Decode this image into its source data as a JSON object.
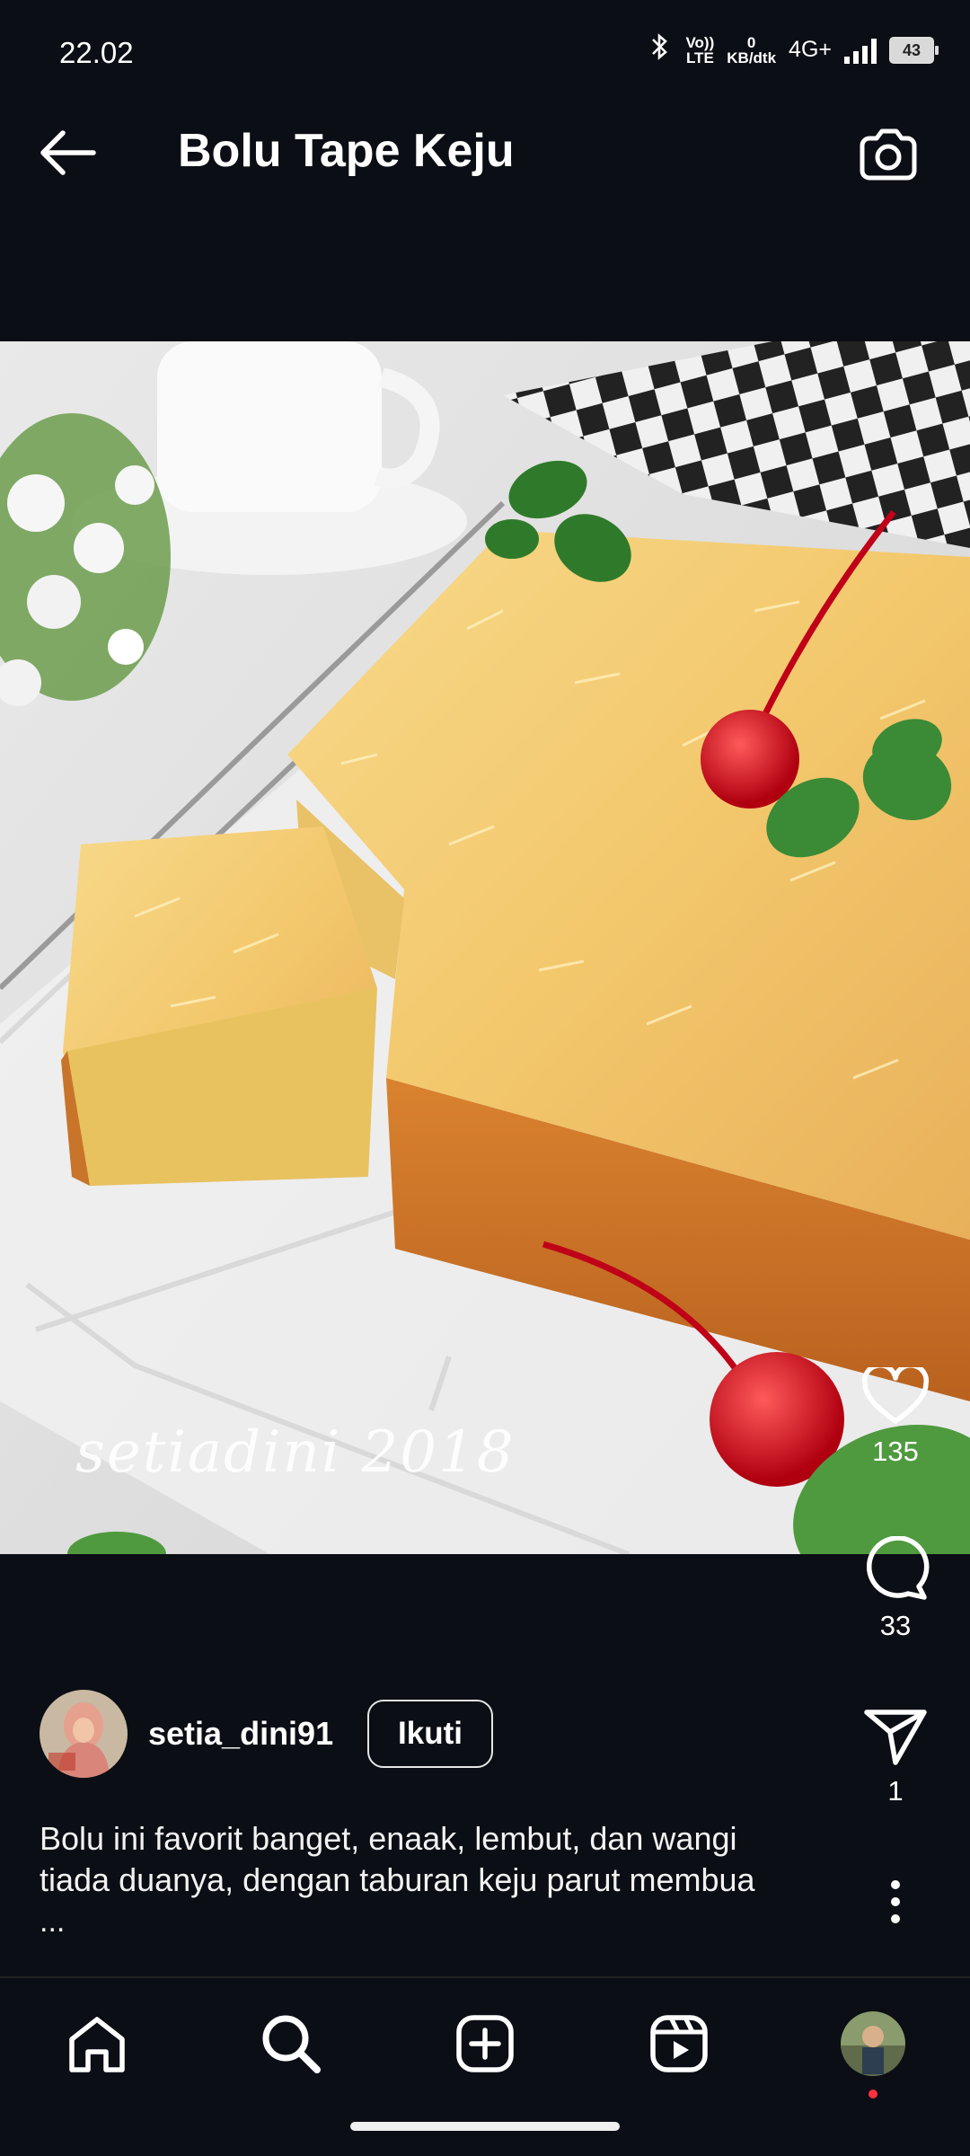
{
  "status_bar": {
    "time": "22.02",
    "network_top": "Vo))",
    "network_bottom": "LTE",
    "speed_top": "0",
    "speed_bottom": "KB/dtk",
    "network_type": "4G+",
    "battery": "43"
  },
  "header": {
    "title": "Bolu Tape Keju"
  },
  "photo": {
    "watermark": "setiadini  2018"
  },
  "actions": {
    "likes": "135",
    "comments": "33",
    "shares": "1"
  },
  "author": {
    "username": "setia_dini91",
    "follow_label": "Ikuti"
  },
  "caption": {
    "line1": "Bolu ini favorit banget,  enaak, lembut,  dan wangi",
    "line2": "tiada duanya, dengan taburan keju parut membua",
    "more": "..."
  },
  "colors": {
    "background": "#0b0e14",
    "text": "#ffffff",
    "notification_dot": "#ff3040"
  }
}
